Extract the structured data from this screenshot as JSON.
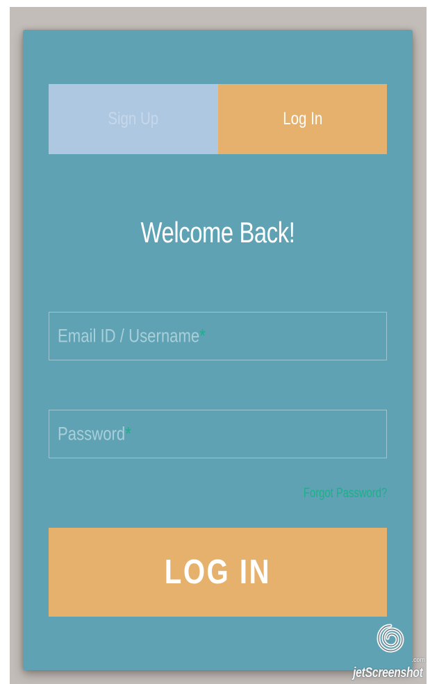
{
  "tabs": {
    "signup_label": "Sign Up",
    "login_label": "Log In"
  },
  "heading": "Welcome Back!",
  "fields": {
    "email_placeholder": "Email ID / Username",
    "password_placeholder": "Password",
    "required_marker": "*"
  },
  "forgot_password": "Forgot Password?",
  "login_button": "LOG IN",
  "watermark": {
    "text": "jetScreenshot",
    "suffix": ".com",
    "icon": "jetscreenshot-logo-icon"
  },
  "colors": {
    "card": "#5fa2b4",
    "accent": "#e6b16c",
    "inactive_tab": "#aec8e1",
    "required": "#1ab188"
  }
}
